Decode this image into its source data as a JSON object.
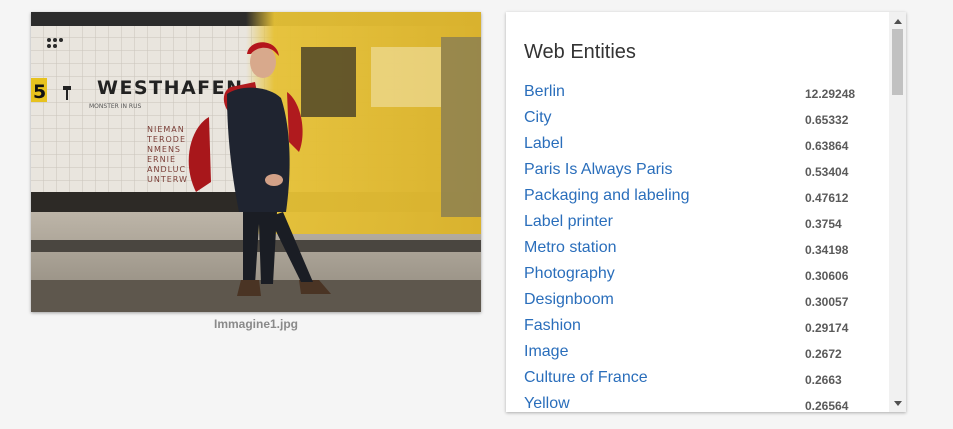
{
  "image": {
    "filename": "Immagine1.jpg",
    "sign_text": "WESTHAFEN",
    "sign_number": "5",
    "sign_subtext": "MONSTER IN RUS",
    "wall_names": [
      "NIEMAN",
      "TERODE",
      "NMENS",
      "ERNIE",
      "ANDLUC",
      "UNTERW"
    ],
    "colors": {
      "tiles": "#e8e4dd",
      "train": "#e8c43a",
      "coat": "#1f2430",
      "scarf": "#b01a1e"
    }
  },
  "panel": {
    "title": "Web Entities",
    "link_color": "#2a6ebb",
    "entities": [
      {
        "name": "Berlin",
        "score": "12.29248"
      },
      {
        "name": "City",
        "score": "0.65332"
      },
      {
        "name": "Label",
        "score": "0.63864"
      },
      {
        "name": "Paris Is Always Paris",
        "score": "0.53404"
      },
      {
        "name": "Packaging and labeling",
        "score": "0.47612"
      },
      {
        "name": "Label printer",
        "score": "0.3754"
      },
      {
        "name": "Metro station",
        "score": "0.34198"
      },
      {
        "name": "Photography",
        "score": "0.30606"
      },
      {
        "name": "Designboom",
        "score": "0.30057"
      },
      {
        "name": "Fashion",
        "score": "0.29174"
      },
      {
        "name": "Image",
        "score": "0.2672"
      },
      {
        "name": "Culture of France",
        "score": "0.2663"
      },
      {
        "name": "Yellow",
        "score": "0.26564"
      }
    ]
  }
}
